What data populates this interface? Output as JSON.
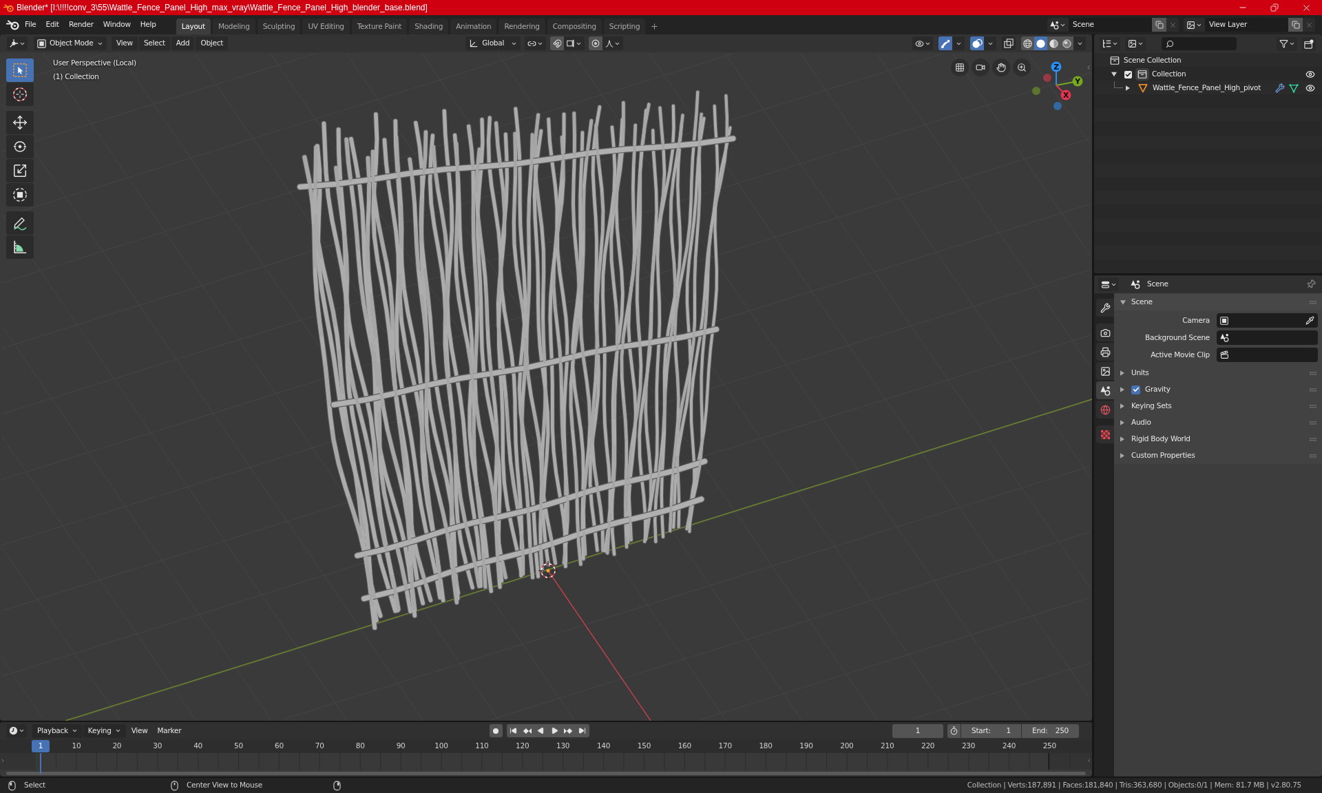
{
  "window": {
    "title": "Blender* [I:\\!!!!conv_3\\55\\Wattle_Fence_Panel_High_max_vray\\Wattle_Fence_Panel_High_blender_base.blend]"
  },
  "menu": [
    "File",
    "Edit",
    "Render",
    "Window",
    "Help"
  ],
  "workspaces": [
    {
      "label": "Layout",
      "selected": true
    },
    {
      "label": "Modeling",
      "selected": false
    },
    {
      "label": "Sculpting",
      "selected": false
    },
    {
      "label": "UV Editing",
      "selected": false
    },
    {
      "label": "Texture Paint",
      "selected": false
    },
    {
      "label": "Shading",
      "selected": false
    },
    {
      "label": "Animation",
      "selected": false
    },
    {
      "label": "Rendering",
      "selected": false
    },
    {
      "label": "Compositing",
      "selected": false
    },
    {
      "label": "Scripting",
      "selected": false
    }
  ],
  "scene_selector": {
    "value": "Scene"
  },
  "view_layer_selector": {
    "value": "View Layer"
  },
  "viewport": {
    "mode": "Object Mode",
    "menus": [
      "View",
      "Select",
      "Add",
      "Object"
    ],
    "orientation": "Global",
    "toggles": [
      {
        "kind": "gizmo",
        "on": true
      },
      {
        "kind": "overlay",
        "on": true
      },
      {
        "kind": "xray",
        "on": false
      }
    ],
    "shading": [
      {
        "kind": "wireframe",
        "selected": false
      },
      {
        "kind": "solid",
        "selected": true
      },
      {
        "kind": "material",
        "selected": false
      },
      {
        "kind": "rendered",
        "selected": false
      }
    ],
    "info": [
      "User Perspective (Local)",
      "(1) Collection"
    ],
    "tools": [
      {
        "kind": "select",
        "selected": true
      },
      {
        "kind": "cursor",
        "selected": false
      },
      {
        "kind": "move",
        "selected": false
      },
      {
        "kind": "rotate",
        "selected": false
      },
      {
        "kind": "scale",
        "selected": false
      },
      {
        "kind": "transform",
        "selected": false
      },
      {
        "kind": "annotate",
        "selected": false
      },
      {
        "kind": "measure",
        "selected": false
      }
    ],
    "gizmo_axes": [
      {
        "label": "Z",
        "color": "#2a8ff4"
      },
      {
        "label": "Y",
        "color": "#76a820"
      },
      {
        "label": "X",
        "color": "#e5354e"
      }
    ]
  },
  "outliner": {
    "tree": [
      {
        "label": "Scene Collection",
        "kind": "scene_collection",
        "children": [
          {
            "label": "Collection",
            "kind": "collection",
            "expanded": true,
            "checked": true,
            "visible": true,
            "children": [
              {
                "label": "Wattle_Fence_Panel_High_pivot",
                "kind": "object",
                "expanded": false,
                "visible": true
              }
            ]
          }
        ]
      }
    ]
  },
  "properties": {
    "context": "Scene",
    "tabs": [
      {
        "kind": "tool",
        "selected": false
      },
      {
        "kind": "render",
        "selected": false
      },
      {
        "kind": "output",
        "selected": false
      },
      {
        "kind": "view_layer",
        "selected": false
      },
      {
        "kind": "scene",
        "selected": true
      },
      {
        "kind": "world",
        "selected": false
      },
      {
        "kind": "texture",
        "selected": false
      }
    ],
    "panels": [
      {
        "title": "Scene",
        "kind": "panel",
        "expanded": true,
        "fields": [
          {
            "label": "Camera",
            "kind": "camera"
          },
          {
            "label": "Background Scene",
            "kind": "scene"
          },
          {
            "label": "Active Movie Clip",
            "kind": "clip"
          }
        ]
      },
      {
        "title": "Units",
        "kind": "panel",
        "expanded": false
      },
      {
        "title": "Gravity",
        "kind": "toggle",
        "expanded": false,
        "checked": true
      },
      {
        "title": "Keying Sets",
        "kind": "panel",
        "expanded": false
      },
      {
        "title": "Audio",
        "kind": "panel",
        "expanded": false
      },
      {
        "title": "Rigid Body World",
        "kind": "panel",
        "expanded": false
      },
      {
        "title": "Custom Properties",
        "kind": "panel",
        "expanded": false
      }
    ]
  },
  "timeline": {
    "menus": [
      {
        "label": "Playback",
        "kind": "dropdown"
      },
      {
        "label": "Keying",
        "kind": "dropdown"
      },
      {
        "label": "View",
        "kind": "menu"
      },
      {
        "label": "Marker",
        "kind": "menu"
      }
    ],
    "current_frame": "1",
    "start": {
      "label": "Start:",
      "value": "1"
    },
    "end": {
      "label": "End:",
      "value": "250"
    },
    "playhead": "1",
    "ruler": [
      "10",
      "20",
      "30",
      "40",
      "50",
      "60",
      "70",
      "80",
      "90",
      "100",
      "110",
      "120",
      "130",
      "140",
      "150",
      "160",
      "170",
      "180",
      "190",
      "200",
      "210",
      "220",
      "230",
      "240",
      "250"
    ]
  },
  "status_bar": {
    "hints": [
      {
        "kind": "left",
        "label": "Select"
      },
      {
        "kind": "middle",
        "label": "Center View to Mouse"
      },
      {
        "kind": "right"
      }
    ],
    "stats": "Collection | Verts:187,891 | Faces:181,840 | Tris:363,680 | Objects:0/1 | Mem: 81.7 MB | v2.80.75"
  }
}
